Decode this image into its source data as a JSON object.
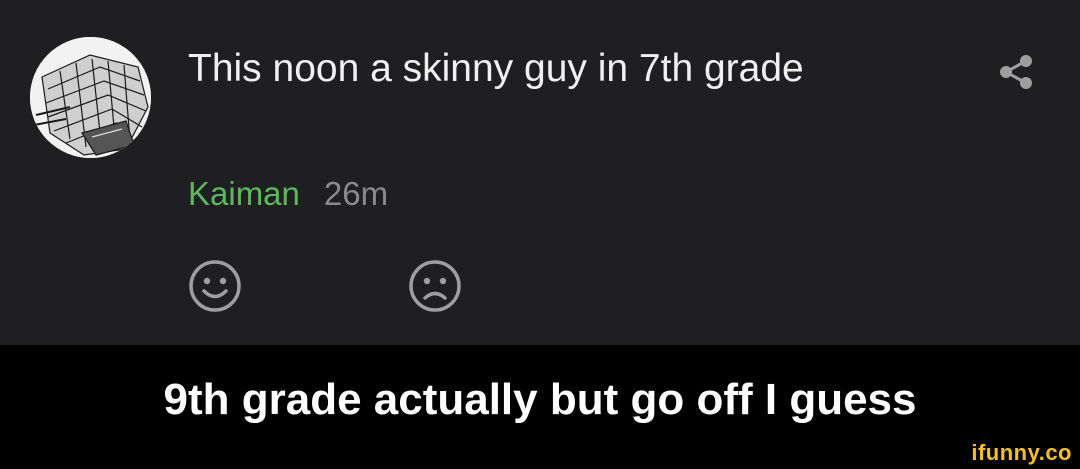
{
  "post": {
    "title": "This noon a skinny guy in 7th grade",
    "author": "Kaiman",
    "time": "26m"
  },
  "icons": {
    "avatar": "reptile-sketch-avatar",
    "share": "share-icon",
    "happy": "smiley-face-icon",
    "sad": "sad-face-icon"
  },
  "caption": "9th grade actually but go off I guess",
  "watermark": "ifunny.co",
  "colors": {
    "background": "#1f1f22",
    "author": "#5cb85c",
    "time": "#8a8a8a",
    "icons": "#9e9e9e",
    "watermark": "#f6c11a"
  }
}
